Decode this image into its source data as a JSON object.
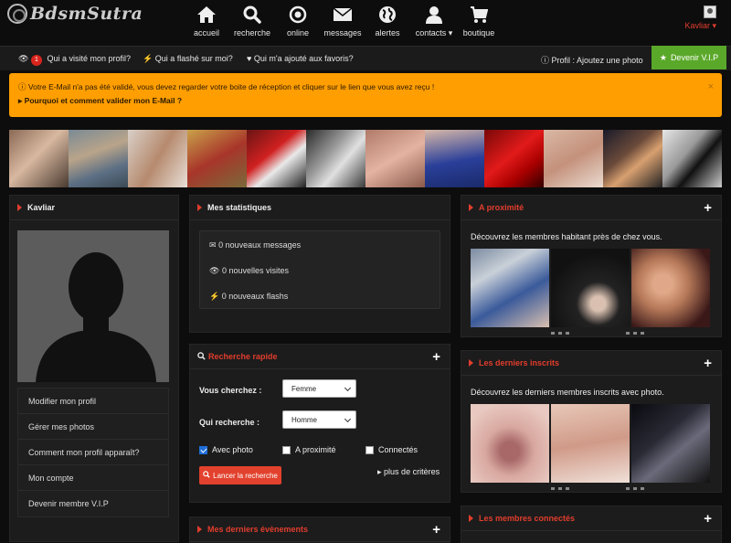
{
  "logo": {
    "text": "BdsmSutra"
  },
  "nav": [
    {
      "label": "accueil",
      "icon": "home-icon"
    },
    {
      "label": "recherche",
      "icon": "search-icon"
    },
    {
      "label": "online",
      "icon": "online-icon"
    },
    {
      "label": "messages",
      "icon": "mail-icon"
    },
    {
      "label": "alertes",
      "icon": "globe-icon"
    },
    {
      "label": "contacts",
      "icon": "user-icon"
    },
    {
      "label": "boutique",
      "icon": "cart-icon"
    }
  ],
  "user": {
    "name": "Kavliar"
  },
  "subnav": {
    "visited": "Qui a visité mon profil?",
    "visited_count": "1",
    "flashed": "Qui a flashé sur moi?",
    "favorites": "Qui m'a ajouté aux favoris?",
    "profile_photo": "Profil : Ajoutez une photo",
    "vip": "Devenir V.I.P"
  },
  "alert": {
    "message": "Votre E-Mail n'a pas été validé, vous devez regarder votre boite de réception et cliquer sur le lien que vous avez reçu !",
    "link": "Pourquoi et comment valider mon E-Mail ?",
    "close": "×"
  },
  "profile_panel": {
    "title": "Kavliar",
    "menu": [
      "Modifier mon profil",
      "Gérer mes photos",
      "Comment mon profil apparaît?",
      "Mon compte",
      "Devenir membre V.I.P"
    ]
  },
  "stats_panel": {
    "title": "Mes statistiques",
    "messages": "0 nouveaux messages",
    "visits": "0 nouvelles visites",
    "flashs": "0 nouveaux flashs"
  },
  "quick_search": {
    "title": "Recherche rapide",
    "seeking_label": "Vous cherchez :",
    "seeking_value": "Femme",
    "who_label": "Qui recherche :",
    "who_value": "Homme",
    "with_photo": "Avec photo",
    "with_photo_checked": true,
    "nearby": "A proximité",
    "nearby_checked": false,
    "connected": "Connectés",
    "connected_checked": false,
    "submit": "Lancer la recherche",
    "more": "plus de critères"
  },
  "events_panel": {
    "title": "Mes derniers évènements"
  },
  "nearby_panel": {
    "title": "A proximité",
    "text": "Découvrez les membres habitant près de chez vous."
  },
  "latest_panel": {
    "title": "Les derniers inscrits",
    "text": "Découvrez les derniers membres inscrits avec photo."
  },
  "connected_panel": {
    "title": "Les membres connectés"
  },
  "colors": {
    "accent": "#e23d2d",
    "alert": "#ff9e00",
    "vip": "#5aa829",
    "background": "#0d0d0d",
    "panel": "#1c1c1c"
  }
}
